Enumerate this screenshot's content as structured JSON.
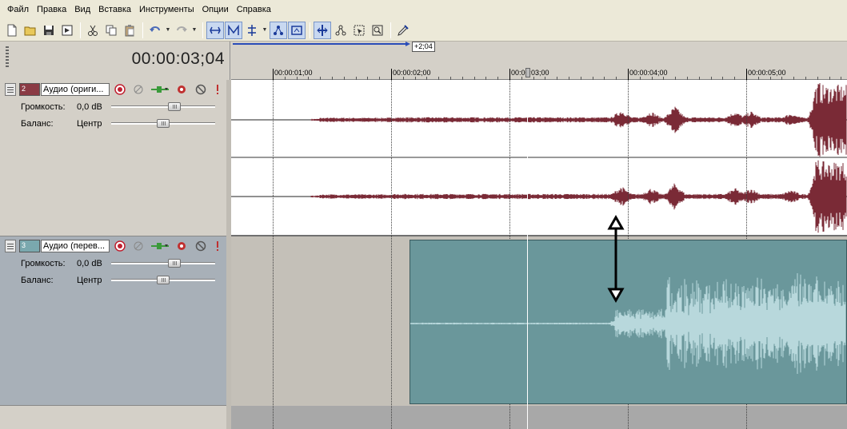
{
  "menu": [
    "Файл",
    "Правка",
    "Вид",
    "Вставка",
    "Инструменты",
    "Опции",
    "Справка"
  ],
  "toolbar_icons": [
    "new-icon",
    "open-icon",
    "save-icon",
    "properties-icon",
    "cut-icon",
    "copy-icon",
    "paste-icon",
    "undo-icon",
    "redo-icon",
    "normal-edit-icon",
    "envelope-edit-icon",
    "ripple-edit-icon",
    "auto-crossfade-icon",
    "snap-icon",
    "split-icon",
    "enable-snapping-icon",
    "selection-icon",
    "zoom-icon",
    "pen-icon"
  ],
  "timecode": "00:00:03;04",
  "ruler": {
    "badge": "+2;04",
    "labels": [
      "00:00:01;00",
      "00:00:02;00",
      "00:00:03;00",
      "00:00:04;00",
      "00:00:05;00"
    ]
  },
  "tracks": [
    {
      "number": "2",
      "name": "Аудио (ориги...",
      "color": "#8a3a44",
      "volume_label": "Громкость:",
      "volume_value": "0,0 dB",
      "volume_level": 0.62,
      "balance_label": "Баланс:",
      "balance_value": "Центр",
      "balance_level": 0.5
    },
    {
      "number": "3",
      "name": "Аудио (перев...",
      "color": "#7aa8ae",
      "volume_label": "Громкость:",
      "volume_value": "0,0 dB",
      "volume_level": 0.62,
      "balance_label": "Баланс:",
      "balance_value": "Центр",
      "balance_level": 0.5
    }
  ],
  "waveform_colors": {
    "original": "#7a2a36",
    "translated": "#b8d8dc"
  },
  "annotation_arrow_color": "#000000"
}
